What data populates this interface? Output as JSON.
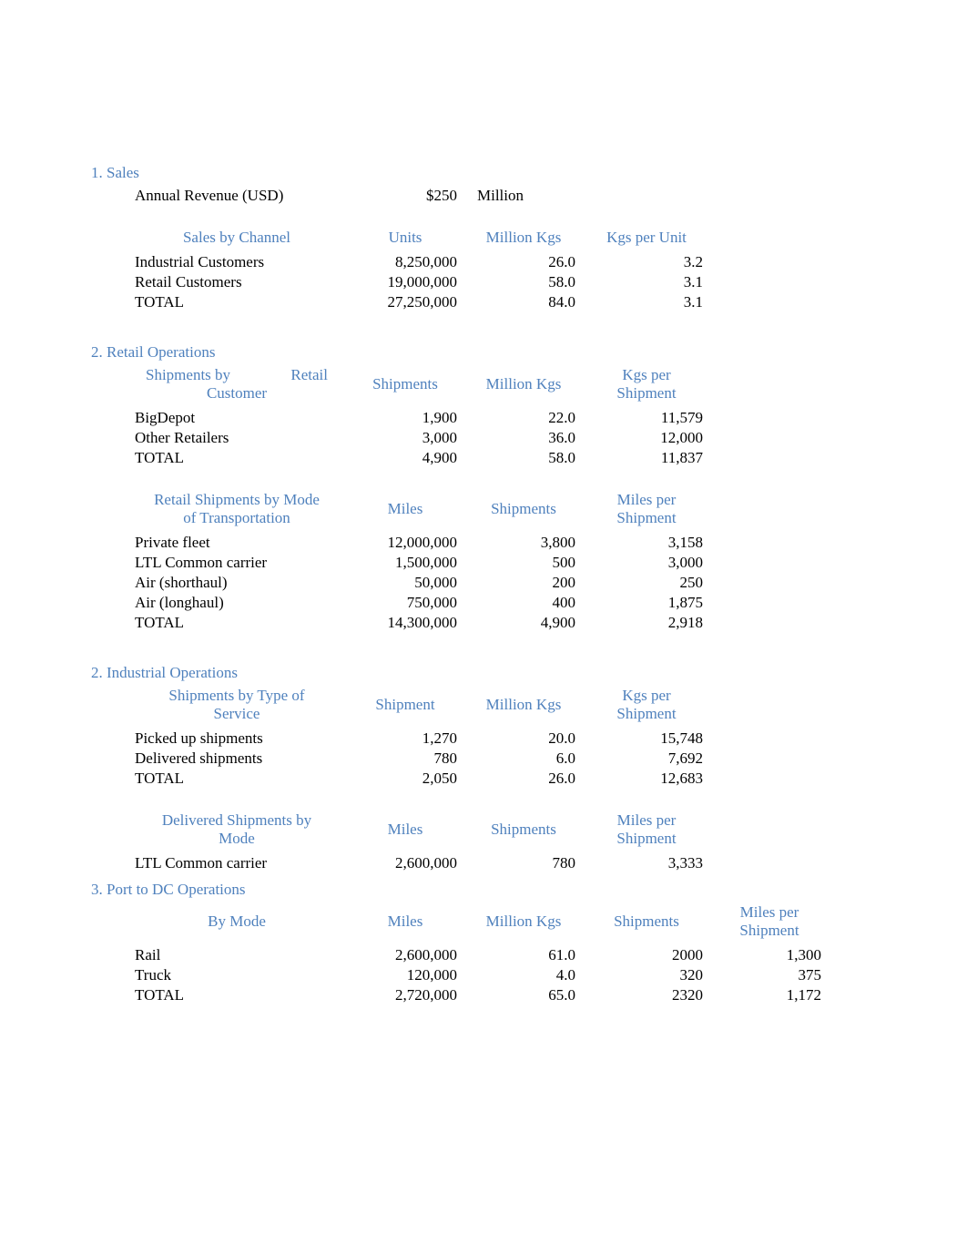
{
  "sections": {
    "sales": {
      "heading": "1. Sales",
      "revenue_label": "Annual Revenue (USD)",
      "revenue_value": "$250",
      "revenue_unit": "Million",
      "channel_table": {
        "header_label": "Sales by Channel",
        "col_a": "Units",
        "col_b": "Million Kgs",
        "col_c": "Kgs per Unit",
        "rows": [
          {
            "label": "Industrial Customers",
            "a": "8,250,000",
            "b": "26.0",
            "c": "3.2"
          },
          {
            "label": "Retail Customers",
            "a": "19,000,000",
            "b": "58.0",
            "c": "3.1"
          },
          {
            "label": "TOTAL",
            "a": "27,250,000",
            "b": "84.0",
            "c": "3.1"
          }
        ]
      }
    },
    "retail": {
      "heading": "2. Retail Operations",
      "cust_table": {
        "header_label_l1": "Shipments by",
        "header_label_r1": "Retail",
        "header_label_l2": "Customer",
        "col_a": "Shipments",
        "col_b": "Million Kgs",
        "col_c_l1": "Kgs per",
        "col_c_l2": "Shipment",
        "rows": [
          {
            "label": "BigDepot",
            "a": "1,900",
            "b": "22.0",
            "c": "11,579"
          },
          {
            "label": "Other Retailers",
            "a": "3,000",
            "b": "36.0",
            "c": "12,000"
          },
          {
            "label": "TOTAL",
            "a": "4,900",
            "b": "58.0",
            "c": "11,837"
          }
        ]
      },
      "mode_table": {
        "header_label_l1": "Retail Shipments by Mode",
        "header_label_l2": "of Transportation",
        "col_a": "Miles",
        "col_b": "Shipments",
        "col_c_l1": "Miles per",
        "col_c_l2": "Shipment",
        "rows": [
          {
            "label": "Private fleet",
            "a": "12,000,000",
            "b": "3,800",
            "c": "3,158"
          },
          {
            "label": "LTL Common carrier",
            "a": "1,500,000",
            "b": "500",
            "c": "3,000"
          },
          {
            "label": "Air (shorthaul)",
            "a": "50,000",
            "b": "200",
            "c": "250"
          },
          {
            "label": "Air (longhaul)",
            "a": "750,000",
            "b": "400",
            "c": "1,875"
          },
          {
            "label": "TOTAL",
            "a": "14,300,000",
            "b": "4,900",
            "c": "2,918"
          }
        ]
      }
    },
    "industrial": {
      "heading": "2. Industrial Operations",
      "svc_table": {
        "header_label_l1": "Shipments by Type of",
        "header_label_l2": "Service",
        "col_a": "Shipment",
        "col_b": "Million Kgs",
        "col_c_l1": "Kgs per",
        "col_c_l2": "Shipment",
        "rows": [
          {
            "label": "Picked up shipments",
            "a": "1,270",
            "b": "20.0",
            "c": "15,748"
          },
          {
            "label": "Delivered shipments",
            "a": "780",
            "b": "6.0",
            "c": "7,692"
          },
          {
            "label": "TOTAL",
            "a": "2,050",
            "b": "26.0",
            "c": "12,683"
          }
        ]
      },
      "deliv_table": {
        "header_label_l1": "Delivered Shipments by",
        "header_label_l2": "Mode",
        "col_a": "Miles",
        "col_b": "Shipments",
        "col_c_l1": "Miles per",
        "col_c_l2": "Shipment",
        "rows": [
          {
            "label": "LTL Common carrier",
            "a": "2,600,000",
            "b": "780",
            "c": "3,333"
          }
        ]
      }
    },
    "port": {
      "heading": "3. Port to DC Operations",
      "mode_table": {
        "header_label": "By Mode",
        "col_a": "Miles",
        "col_b": "Million Kgs",
        "col_c": "Shipments",
        "col_d_l1": "Miles per",
        "col_d_l2": "Shipment",
        "rows": [
          {
            "label": "Rail",
            "a": "2,600,000",
            "b": "61.0",
            "c": "2000",
            "d": "1,300"
          },
          {
            "label": "Truck",
            "a": "120,000",
            "b": "4.0",
            "c": "320",
            "d": "375"
          },
          {
            "label": "TOTAL",
            "a": "2,720,000",
            "b": "65.0",
            "c": "2320",
            "d": "1,172"
          }
        ]
      }
    }
  }
}
